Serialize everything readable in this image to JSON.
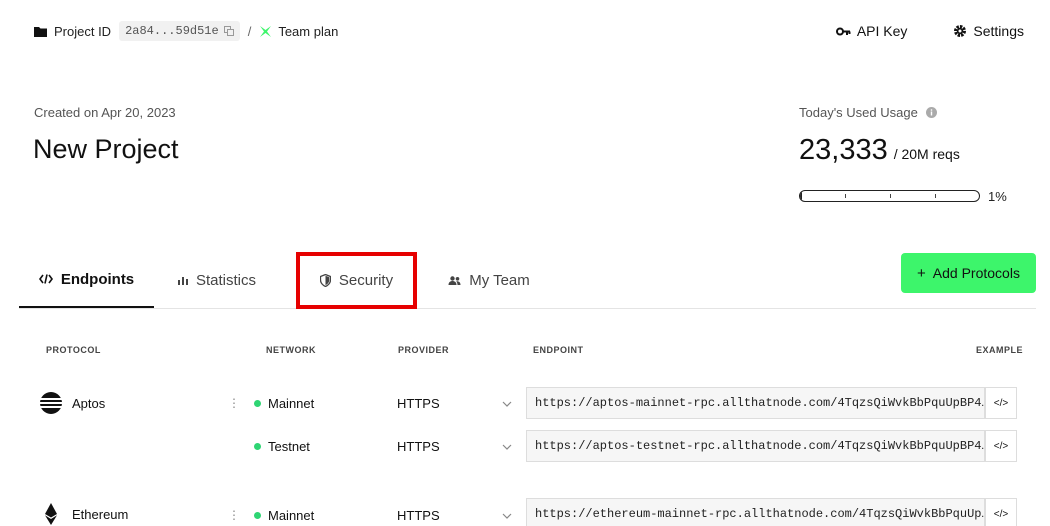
{
  "breadcrumb": {
    "project_label": "Project ID",
    "project_id": "2a84...59d51e",
    "separator": "/",
    "plan": "Team plan"
  },
  "top_actions": {
    "api_key": "API Key",
    "settings": "Settings"
  },
  "project": {
    "created": "Created on Apr 20, 2023",
    "title": "New Project"
  },
  "usage": {
    "label": "Today's Used Usage",
    "value": "23,333",
    "limit": "/ 20M reqs",
    "percent_text": "1%",
    "percent": 1
  },
  "tabs": [
    {
      "label": "Endpoints",
      "icon": "code-icon",
      "active": true
    },
    {
      "label": "Statistics",
      "icon": "bar-chart-icon",
      "active": false
    },
    {
      "label": "Security",
      "icon": "shield-icon",
      "active": false
    },
    {
      "label": "My Team",
      "icon": "people-icon",
      "active": false
    }
  ],
  "add_button": "+ Add Protocols",
  "add_button_label": "Add Protocols",
  "table": {
    "headers": {
      "protocol": "PROTOCOL",
      "network": "NETWORK",
      "provider": "PROVIDER",
      "endpoint": "ENDPOINT",
      "example": "EXAMPLE"
    },
    "rows": [
      {
        "protocol": "Aptos",
        "network": "Mainnet",
        "provider": "HTTPS",
        "endpoint": "https://aptos-mainnet-rpc.allthatnode.com/4TqzsQiWvkBbPquUpBP4…",
        "example": "</>"
      },
      {
        "protocol": "",
        "network": "Testnet",
        "provider": "HTTPS",
        "endpoint": "https://aptos-testnet-rpc.allthatnode.com/4TqzsQiWvkBbPquUpBP4…",
        "example": "</>"
      },
      {
        "protocol": "Ethereum",
        "network": "Mainnet",
        "provider": "HTTPS",
        "endpoint": "https://ethereum-mainnet-rpc.allthatnode.com/4TqzsQiWvkBbPquUp…",
        "example": "</>"
      }
    ]
  },
  "colors": {
    "accent": "#3df56b",
    "status_dot": "#2ed573",
    "highlight_box": "#e60000"
  }
}
